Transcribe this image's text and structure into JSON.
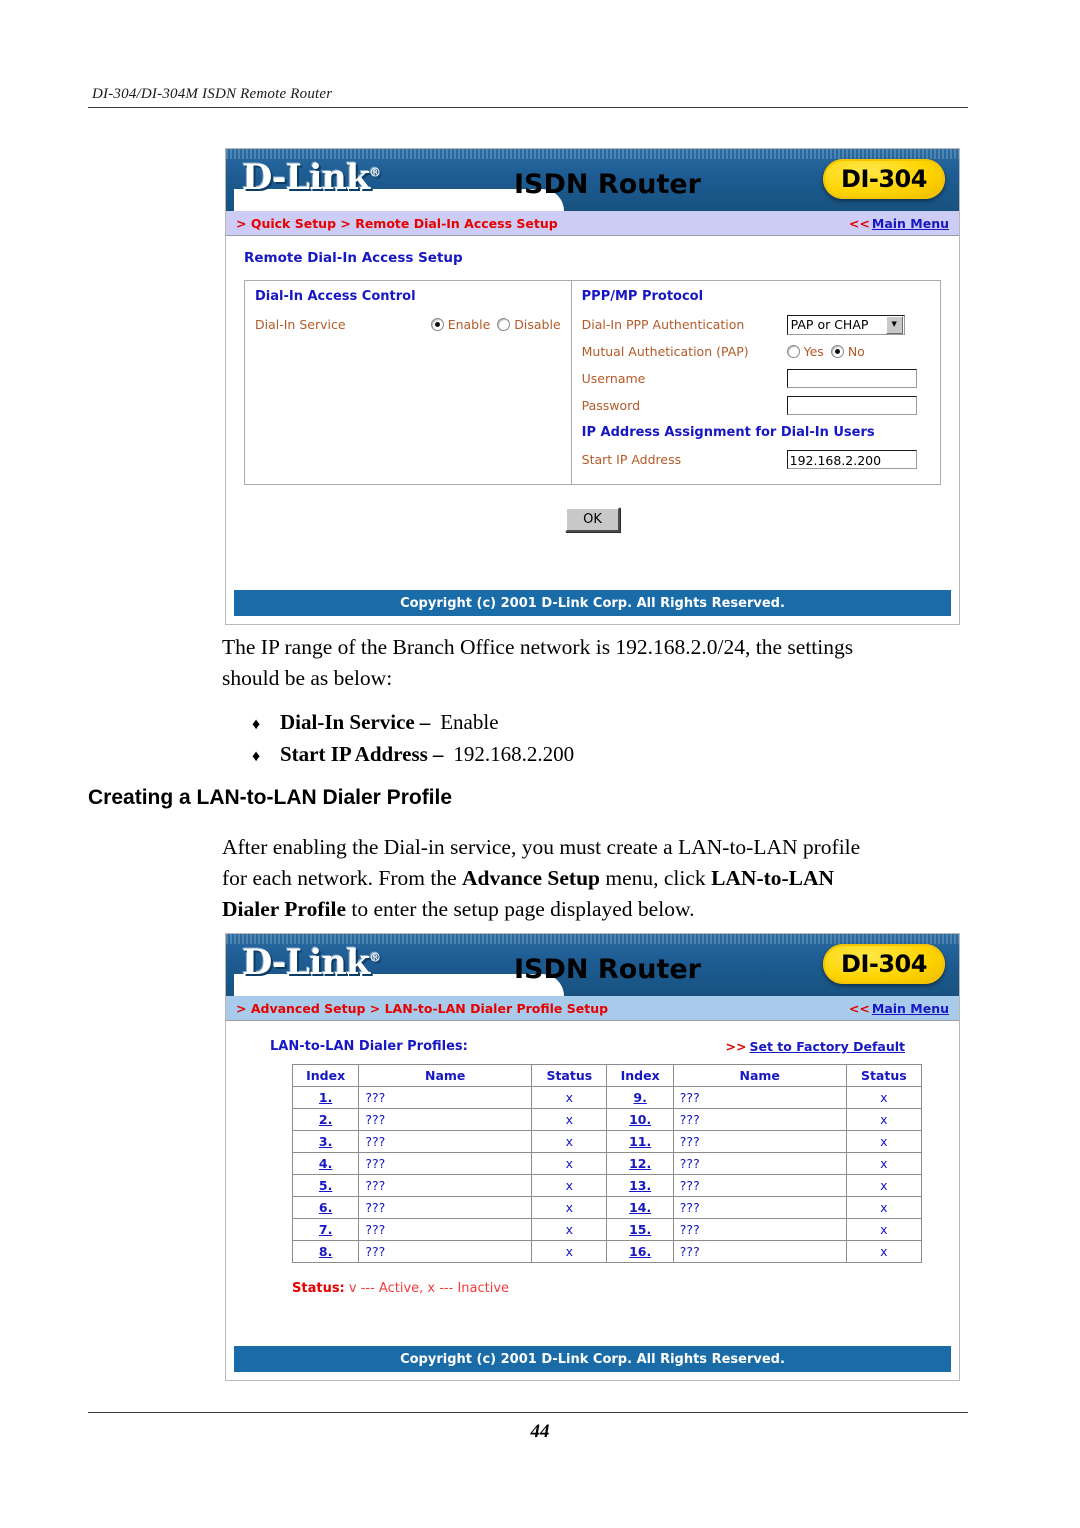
{
  "page": {
    "running_header": "DI-304/DI-304M ISDN Remote Router",
    "page_number": "44"
  },
  "screenshot_dialin": {
    "banner": {
      "logo": "D-Link",
      "logo_registered": "®",
      "title": "ISDN Router",
      "model_badge": "DI-304"
    },
    "nav": {
      "breadcrumb": "> Quick Setup > Remote Dial-In Access Setup",
      "main_menu_prefix": "<<",
      "main_menu_label": "Main Menu"
    },
    "section_title": "Remote Dial-In Access Setup",
    "left_panel": {
      "heading": "Dial-In Access Control",
      "service_label": "Dial-In Service",
      "enable_label": "Enable",
      "disable_label": "Disable"
    },
    "right_panel": {
      "heading": "PPP/MP Protocol",
      "ppp_auth_label": "Dial-In PPP Authentication",
      "ppp_auth_value": "PAP or CHAP",
      "mutual_auth_label": "Mutual Authetication (PAP)",
      "mutual_yes_label": "Yes",
      "mutual_no_label": "No",
      "username_label": "Username",
      "username_value": "",
      "password_label": "Password",
      "password_value": "",
      "ip_assign_heading": "IP Address Assignment for Dial-In Users",
      "start_ip_label": "Start IP Address",
      "start_ip_value": "192.168.2.200"
    },
    "ok_button": "OK",
    "copyright": "Copyright (c) 2001 D-Link Corp. All Rights Reserved."
  },
  "body": {
    "intro_paragraph": "The IP range of the Branch Office network is 192.168.2.0/24, the settings should be as below:",
    "bullets": [
      {
        "mark": "♦",
        "term": "Dial-In Service",
        "dash": "–",
        "value": "Enable"
      },
      {
        "mark": "♦",
        "term": "Start IP Address",
        "dash": "–",
        "value": "192.168.2.200"
      }
    ],
    "heading": "Creating a LAN-to-LAN Dialer Profile",
    "paragraph_parts": {
      "p1": "After enabling the Dial-in service, you must create a LAN-to-LAN profile for each network. From the ",
      "b1": "Advance Setup",
      "p2": " menu, click ",
      "b2": "LAN-to-LAN Dialer Profile",
      "p3": " to enter the setup page displayed below."
    }
  },
  "screenshot_profiles": {
    "banner": {
      "logo": "D-Link",
      "logo_registered": "®",
      "title": "ISDN Router",
      "model_badge": "DI-304"
    },
    "nav": {
      "breadcrumb": "> Advanced Setup > LAN-to-LAN Dialer Profile Setup",
      "main_menu_prefix": "<<",
      "main_menu_label": "Main Menu"
    },
    "profiles_title": "LAN-to-LAN Dialer Profiles:",
    "factory_prefix": ">>",
    "factory_label": "Set to Factory Default",
    "table": {
      "headers": [
        "Index",
        "Name",
        "Status",
        "Index",
        "Name",
        "Status"
      ],
      "rows": [
        {
          "index_a": "1.",
          "name_a": "???",
          "status_a": "x",
          "index_b": "9.",
          "name_b": "???",
          "status_b": "x"
        },
        {
          "index_a": "2.",
          "name_a": "???",
          "status_a": "x",
          "index_b": "10.",
          "name_b": "???",
          "status_b": "x"
        },
        {
          "index_a": "3.",
          "name_a": "???",
          "status_a": "x",
          "index_b": "11.",
          "name_b": "???",
          "status_b": "x"
        },
        {
          "index_a": "4.",
          "name_a": "???",
          "status_a": "x",
          "index_b": "12.",
          "name_b": "???",
          "status_b": "x"
        },
        {
          "index_a": "5.",
          "name_a": "???",
          "status_a": "x",
          "index_b": "13.",
          "name_b": "???",
          "status_b": "x"
        },
        {
          "index_a": "6.",
          "name_a": "???",
          "status_a": "x",
          "index_b": "14.",
          "name_b": "???",
          "status_b": "x"
        },
        {
          "index_a": "7.",
          "name_a": "???",
          "status_a": "x",
          "index_b": "15.",
          "name_b": "???",
          "status_b": "x"
        },
        {
          "index_a": "8.",
          "name_a": "???",
          "status_a": "x",
          "index_b": "16.",
          "name_b": "???",
          "status_b": "x"
        }
      ]
    },
    "status_legend_label": "Status:",
    "status_legend_text": "v --- Active, x --- Inactive",
    "copyright": "Copyright (c) 2001 D-Link Corp. All Rights Reserved."
  },
  "colors": {
    "banner_blue": "#1d5b92",
    "badge_yellow": "#ffd400",
    "nav_lavender": "#ccccf5",
    "nav_blue": "#a9cbeb",
    "link_blue": "#1717c4",
    "crumb_red": "#e60000",
    "label_brown": "#b35a27"
  }
}
